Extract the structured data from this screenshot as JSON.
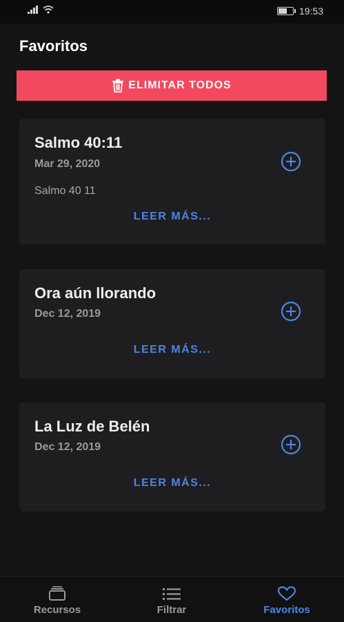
{
  "status": {
    "time": "19:53",
    "battery_level": 0.7
  },
  "page": {
    "title": "Favoritos"
  },
  "actions": {
    "delete_all_label": "ELIMITAR TODOS"
  },
  "favorites": [
    {
      "title": "Salmo 40:11",
      "date": "Mar 29, 2020",
      "snippet": "Salmo 40 11",
      "read_more": "LEER MÁS..."
    },
    {
      "title": "Ora aún llorando",
      "date": "Dec 12, 2019",
      "snippet": "",
      "read_more": "LEER MÁS..."
    },
    {
      "title": "La Luz de Belén",
      "date": "Dec 12, 2019",
      "snippet": "",
      "read_more": "LEER MÁS..."
    }
  ],
  "bottom_nav": [
    {
      "label": "Recursos",
      "icon": "folder-icon",
      "active": false
    },
    {
      "label": "Filtrar",
      "icon": "list-icon",
      "active": false
    },
    {
      "label": "Favoritos",
      "icon": "heart-icon",
      "active": true
    }
  ],
  "colors": {
    "accent": "#4c86e0",
    "danger": "#f2495f",
    "card": "#1e1e21",
    "background": "#141415"
  }
}
